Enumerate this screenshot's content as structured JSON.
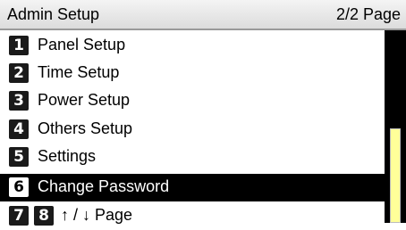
{
  "header": {
    "title": "Admin Setup",
    "page_indicator": "2/2 Page"
  },
  "menu": {
    "items": [
      {
        "badge": "1",
        "label": "Panel Setup"
      },
      {
        "badge": "2",
        "label": "Time Setup"
      },
      {
        "badge": "3",
        "label": "Power Setup"
      },
      {
        "badge": "4",
        "label": "Others Setup"
      },
      {
        "badge": "5",
        "label": "Settings"
      },
      {
        "badge": "6",
        "label": "Change Password"
      }
    ],
    "nav": {
      "badge_prev": "7",
      "badge_next": "8",
      "label": "↑ / ↓ Page"
    }
  }
}
